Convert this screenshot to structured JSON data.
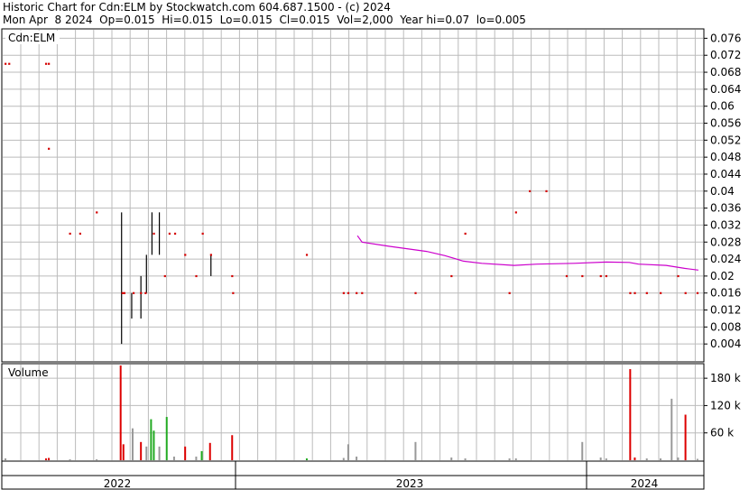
{
  "header": {
    "line1": "Historic Chart for Cdn:ELM by Stockwatch.com 604.687.1500 - (c) 2024",
    "line2": "Mon Apr  8 2024  Op=0.015  Hi=0.015  Lo=0.015  Cl=0.015  Vol=2,000  Year hi=0.07  lo=0.005"
  },
  "price_panel": {
    "label": "Cdn:ELM",
    "yticks": [
      "0.004",
      "0.008",
      "0.012",
      "0.016",
      "0.02",
      "0.024",
      "0.028",
      "0.032",
      "0.036",
      "0.04",
      "0.044",
      "0.048",
      "0.052",
      "0.056",
      "0.06",
      "0.064",
      "0.068",
      "0.072",
      "0.076"
    ]
  },
  "volume_panel": {
    "label": "Volume",
    "yticks": [
      "60 k",
      "120 k",
      "180 k"
    ]
  },
  "x_axis": {
    "years": [
      "2022",
      "2023",
      "2024"
    ]
  },
  "colors": {
    "price_points": "#d40000",
    "moving_average": "#cc00cc",
    "vol_up": "#22aa22",
    "vol_down": "#dd0000",
    "vol_flat": "#999999",
    "grid": "#bbbbbb"
  },
  "chart_data": [
    {
      "type": "scatter",
      "title": "Cdn:ELM",
      "ylim": [
        0,
        0.078
      ],
      "xlim": [
        0,
        760
      ],
      "grid": true,
      "moving_average": [
        [
          385,
          0.0295
        ],
        [
          390,
          0.028
        ],
        [
          420,
          0.027
        ],
        [
          460,
          0.0258
        ],
        [
          480,
          0.0248
        ],
        [
          500,
          0.0235
        ],
        [
          520,
          0.023
        ],
        [
          555,
          0.0225
        ],
        [
          580,
          0.0228
        ],
        [
          620,
          0.023
        ],
        [
          655,
          0.0233
        ],
        [
          680,
          0.0232
        ],
        [
          690,
          0.0228
        ],
        [
          720,
          0.0225
        ],
        [
          740,
          0.0218
        ],
        [
          755,
          0.0214
        ]
      ],
      "price_points": [
        [
          3,
          0.07
        ],
        [
          7,
          0.07
        ],
        [
          47,
          0.07
        ],
        [
          50,
          0.07
        ],
        [
          50,
          0.05
        ],
        [
          73,
          0.03
        ],
        [
          84,
          0.03
        ],
        [
          102,
          0.035
        ],
        [
          130,
          0.016
        ],
        [
          132,
          0.016
        ],
        [
          142,
          0.016
        ],
        [
          150,
          0.016
        ],
        [
          155,
          0.016
        ],
        [
          164,
          0.03
        ],
        [
          176,
          0.02
        ],
        [
          181,
          0.03
        ],
        [
          187,
          0.03
        ],
        [
          198,
          0.025
        ],
        [
          210,
          0.02
        ],
        [
          217,
          0.03
        ],
        [
          226,
          0.025
        ],
        [
          249,
          0.02
        ],
        [
          250,
          0.016
        ],
        [
          330,
          0.025
        ],
        [
          370,
          0.016
        ],
        [
          375,
          0.016
        ],
        [
          384,
          0.016
        ],
        [
          390,
          0.016
        ],
        [
          448,
          0.016
        ],
        [
          487,
          0.02
        ],
        [
          502,
          0.03
        ],
        [
          550,
          0.016
        ],
        [
          557,
          0.035
        ],
        [
          572,
          0.04
        ],
        [
          590,
          0.04
        ],
        [
          612,
          0.02
        ],
        [
          629,
          0.02
        ],
        [
          649,
          0.02
        ],
        [
          655,
          0.02
        ],
        [
          681,
          0.016
        ],
        [
          686,
          0.016
        ],
        [
          699,
          0.016
        ],
        [
          714,
          0.016
        ],
        [
          733,
          0.02
        ],
        [
          741,
          0.016
        ],
        [
          754,
          0.016
        ]
      ],
      "price_bars": [
        [
          129,
          0.004,
          0.035
        ],
        [
          140,
          0.01,
          0.016
        ],
        [
          150,
          0.01,
          0.02
        ],
        [
          156,
          0.016,
          0.025
        ],
        [
          162,
          0.025,
          0.035
        ],
        [
          170,
          0.025,
          0.035
        ],
        [
          226,
          0.02,
          0.025
        ]
      ]
    },
    {
      "type": "bar",
      "title": "Volume",
      "ylim": [
        0,
        210000
      ],
      "yticks": [
        60000,
        120000,
        180000
      ],
      "bars": [
        [
          3,
          4000,
          "flat"
        ],
        [
          47,
          4000,
          "down"
        ],
        [
          50,
          5000,
          "down"
        ],
        [
          73,
          2000,
          "flat"
        ],
        [
          102,
          2000,
          "flat"
        ],
        [
          128,
          208000,
          "down"
        ],
        [
          131,
          35000,
          "down"
        ],
        [
          141,
          70000,
          "flat"
        ],
        [
          150,
          40000,
          "down"
        ],
        [
          156,
          30000,
          "flat"
        ],
        [
          161,
          90000,
          "up"
        ],
        [
          164,
          65000,
          "up"
        ],
        [
          170,
          30000,
          "flat"
        ],
        [
          178,
          95000,
          "up"
        ],
        [
          186,
          8000,
          "flat"
        ],
        [
          198,
          30000,
          "down"
        ],
        [
          210,
          8000,
          "flat"
        ],
        [
          216,
          20000,
          "up"
        ],
        [
          225,
          38000,
          "down"
        ],
        [
          249,
          55000,
          "down"
        ],
        [
          330,
          4000,
          "up"
        ],
        [
          370,
          5000,
          "flat"
        ],
        [
          375,
          35000,
          "flat"
        ],
        [
          384,
          8000,
          "flat"
        ],
        [
          448,
          40000,
          "flat"
        ],
        [
          487,
          6000,
          "flat"
        ],
        [
          502,
          4000,
          "flat"
        ],
        [
          550,
          4000,
          "flat"
        ],
        [
          557,
          4000,
          "flat"
        ],
        [
          629,
          40000,
          "flat"
        ],
        [
          649,
          6000,
          "flat"
        ],
        [
          655,
          4000,
          "flat"
        ],
        [
          681,
          200000,
          "down"
        ],
        [
          686,
          6000,
          "down"
        ],
        [
          699,
          4000,
          "flat"
        ],
        [
          714,
          4000,
          "flat"
        ],
        [
          726,
          135000,
          "flat"
        ],
        [
          733,
          6000,
          "flat"
        ],
        [
          741,
          100000,
          "down"
        ],
        [
          754,
          3000,
          "flat"
        ]
      ]
    }
  ]
}
